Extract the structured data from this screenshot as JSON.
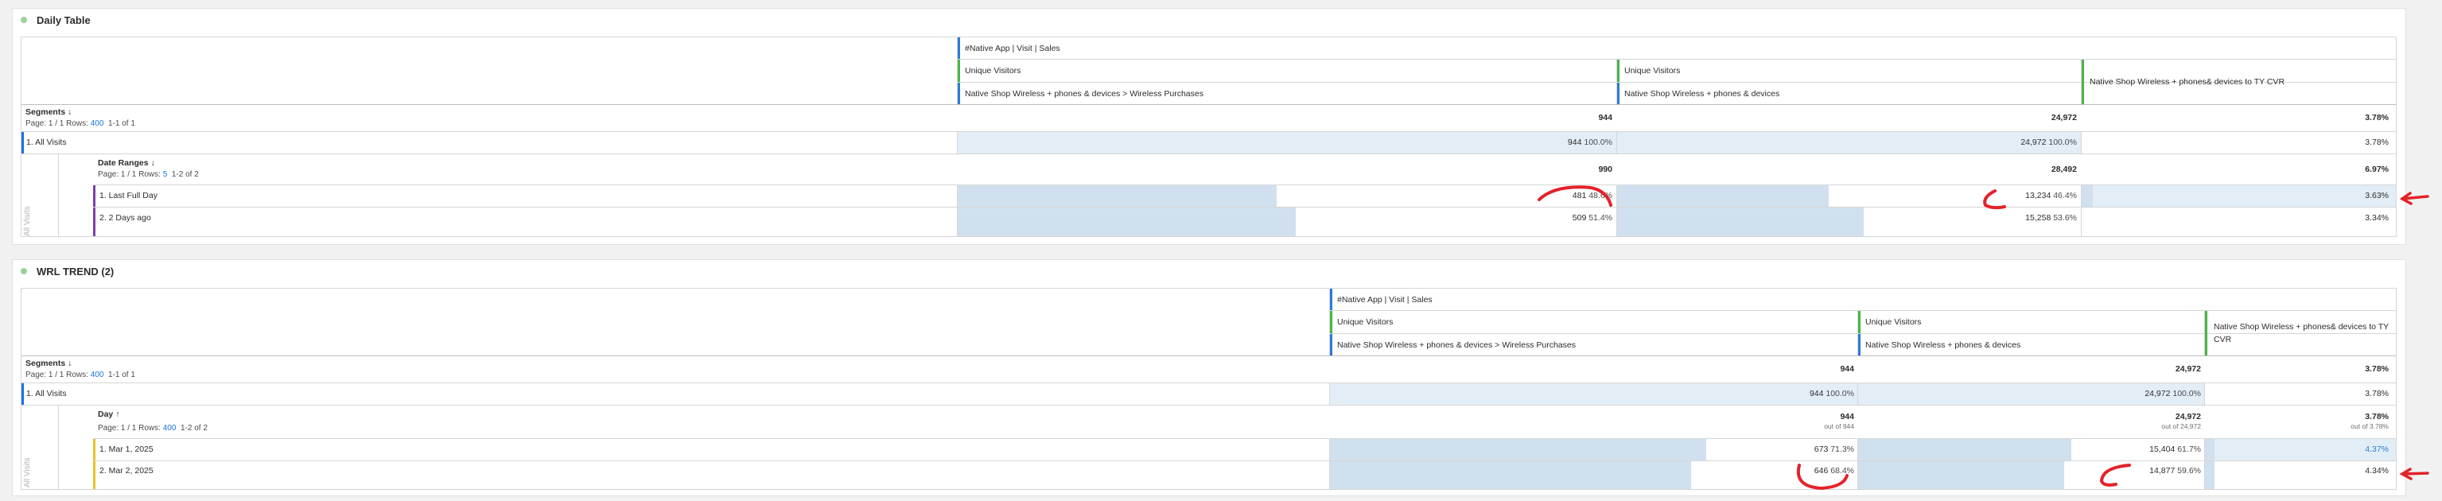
{
  "colors": {
    "segment_bar": "#1473e6",
    "daterange_bar": "#7c3fb2",
    "day_bar": "#e8c12a",
    "metric1": "#2d7bd7",
    "metric2": "#4ab44a",
    "bar_fill": "#d1e0ee",
    "annotation": "#e3222a"
  },
  "panels": [
    {
      "title": "Daily Table",
      "metric_header": {
        "top": "#Native App | Visit | Sales",
        "cols": [
          {
            "name": "Unique Visitors",
            "segment": "Native Shop Wireless + phones & devices > Wireless Purchases"
          },
          {
            "name": "Unique Visitors",
            "segment": "Native Shop Wireless + phones & devices"
          },
          {
            "name": "Native Shop Wireless + phones& devices to TY CVR",
            "segment": ""
          }
        ]
      },
      "segments": {
        "title": "Segments",
        "sort_icon": "arrow-down-icon",
        "page": "Page: 1 / 1 Rows:",
        "rows": "400",
        "range": "1-1 of 1",
        "totals": [
          "944",
          "24,972",
          "3.78%"
        ]
      },
      "all_visits": {
        "label": "1.  All Visits",
        "v1": "944",
        "p1": "100.0%",
        "v2": "24,972",
        "p2": "100.0%",
        "v3": "3.78%"
      },
      "side_label": "All Visits",
      "breakdown": {
        "title": "Date Ranges",
        "sort_icon": "arrow-down-icon",
        "page": "Page: 1 / 1 Rows:",
        "rows": "5",
        "range": "1-2 of 2",
        "totals": [
          "990",
          "28,492",
          "6.97%"
        ],
        "subtotals": [
          "",
          "",
          ""
        ]
      },
      "rows": [
        {
          "label": "1.  Last Full Day",
          "v1": "481",
          "p1": "48.6%",
          "f1": 0.486,
          "v2": "13,234",
          "p2": "46.4%",
          "f2": 0.464,
          "v3": "3.63%",
          "f3": 0.036
        },
        {
          "label": "2.  2 Days ago",
          "v1": "509",
          "p1": "51.4%",
          "f1": 0.514,
          "v2": "15,258",
          "p2": "53.6%",
          "f2": 0.536,
          "v3": "3.34%",
          "f3": 0
        }
      ]
    },
    {
      "title": "WRL TREND (2)",
      "metric_header": {
        "top": "#Native App | Visit | Sales",
        "cols": [
          {
            "name": "Unique Visitors",
            "segment": "Native Shop Wireless + phones & devices > Wireless Purchases"
          },
          {
            "name": "Unique Visitors",
            "segment": "Native Shop Wireless + phones & devices"
          },
          {
            "name": "Native Shop Wireless + phones& devices to TY CVR",
            "segment": ""
          }
        ]
      },
      "segments": {
        "title": "Segments",
        "sort_icon": "arrow-down-icon",
        "page": "Page: 1 / 1 Rows:",
        "rows": "400",
        "range": "1-1 of 1",
        "totals": [
          "944",
          "24,972",
          "3.78%"
        ]
      },
      "all_visits": {
        "label": "1.  All Visits",
        "v1": "944",
        "p1": "100.0%",
        "v2": "24,972",
        "p2": "100.0%",
        "v3": "3.78%"
      },
      "side_label": "All Visits",
      "breakdown": {
        "title": "Day",
        "sort_icon": "arrow-up-icon",
        "page": "Page: 1 / 1 Rows:",
        "rows": "400",
        "range": "1-2 of 2",
        "totals": [
          "944",
          "24,972",
          "3.78%"
        ],
        "subtotals": [
          "out of 944",
          "out of 24,972",
          "out of 3.78%"
        ]
      },
      "rows": [
        {
          "label": "1.  Mar 1, 2025",
          "v1": "673",
          "p1": "71.3%",
          "f1": 0.713,
          "v2": "15,404",
          "p2": "61.7%",
          "f2": 0.617,
          "v3": "4.37%",
          "f3": 0.044
        },
        {
          "label": "2.  Mar 2, 2025",
          "v1": "646",
          "p1": "68.4%",
          "f1": 0.684,
          "v2": "14,877",
          "p2": "59.6%",
          "f2": 0.596,
          "v3": "4.34%",
          "f3": 0.044
        }
      ]
    }
  ]
}
